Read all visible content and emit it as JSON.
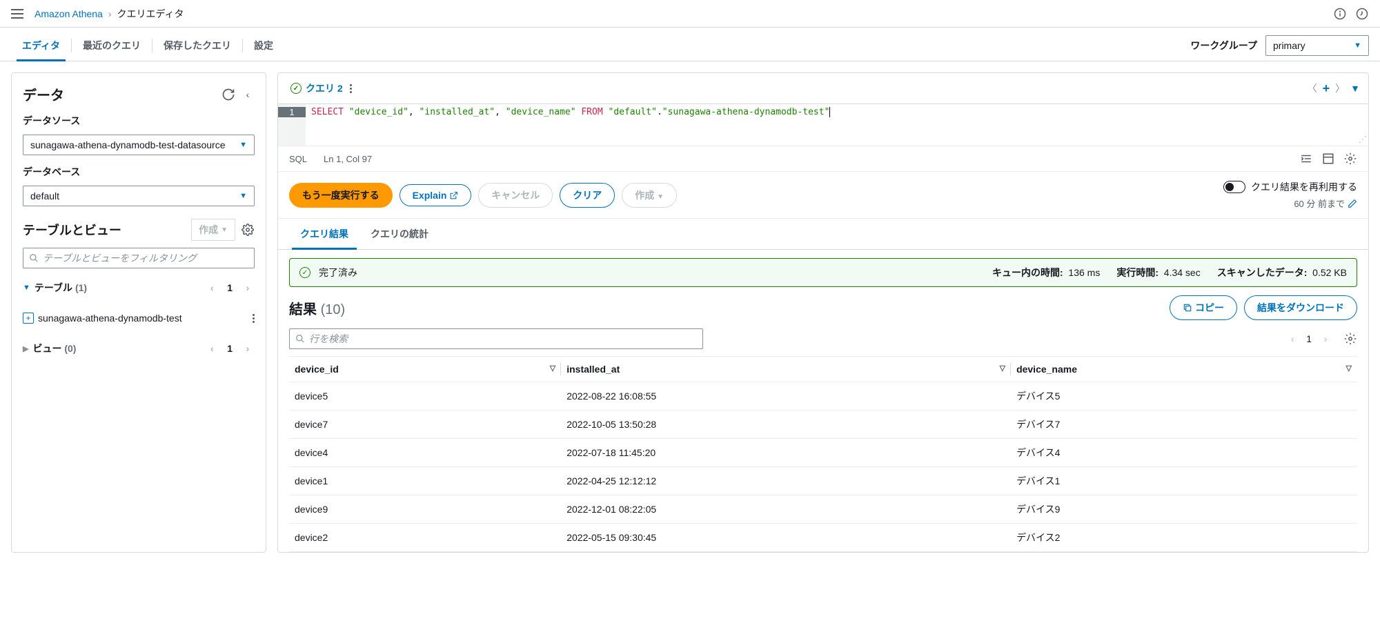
{
  "breadcrumb": {
    "service": "Amazon Athena",
    "page": "クエリエディタ"
  },
  "tabs": {
    "editor": "エディタ",
    "recent": "最近のクエリ",
    "saved": "保存したクエリ",
    "settings": "設定"
  },
  "workgroup": {
    "label": "ワークグループ",
    "value": "primary"
  },
  "sidebar": {
    "title": "データ",
    "datasource_label": "データソース",
    "datasource_value": "sunagawa-athena-dynamodb-test-datasource",
    "database_label": "データベース",
    "database_value": "default",
    "tables_views_title": "テーブルとビュー",
    "create_btn": "作成",
    "filter_placeholder": "テーブルとビューをフィルタリング",
    "tables": {
      "label": "テーブル",
      "count": "(1)",
      "page": "1",
      "item": "sunagawa-athena-dynamodb-test"
    },
    "views": {
      "label": "ビュー",
      "count": "(0)",
      "page": "1"
    }
  },
  "editor": {
    "tab_label": "クエリ 2",
    "line": "1",
    "sql": {
      "kw1": "SELECT",
      "s1": "\"device_id\"",
      "c1": ", ",
      "s2": "\"installed_at\"",
      "c2": ", ",
      "s3": "\"device_name\"",
      "kw2": " FROM ",
      "s4": "\"default\"",
      "dot": ".",
      "s5": "\"sunagawa-athena-dynamodb-test\""
    },
    "lang": "SQL",
    "pos": "Ln 1, Col 97"
  },
  "actions": {
    "run": "もう一度実行する",
    "explain": "Explain",
    "cancel": "キャンセル",
    "clear": "クリア",
    "create": "作成",
    "reuse_label": "クエリ結果を再利用する",
    "reuse_time": "60 分 前まで"
  },
  "result_tabs": {
    "results": "クエリ結果",
    "stats": "クエリの統計"
  },
  "status": {
    "text": "完了済み",
    "queue_label": "キュー内の時間:",
    "queue_val": "136 ms",
    "run_label": "実行時間:",
    "run_val": "4.34 sec",
    "scan_label": "スキャンしたデータ:",
    "scan_val": "0.52 KB"
  },
  "results": {
    "title": "結果",
    "count": "(10)",
    "copy_btn": "コピー",
    "download_btn": "結果をダウンロード",
    "search_placeholder": "行を検索",
    "page": "1",
    "columns": [
      "device_id",
      "installed_at",
      "device_name"
    ],
    "rows": [
      {
        "c0": "device5",
        "c1": "2022-08-22 16:08:55",
        "c2": "デバイス5"
      },
      {
        "c0": "device7",
        "c1": "2022-10-05 13:50:28",
        "c2": "デバイス7"
      },
      {
        "c0": "device4",
        "c1": "2022-07-18 11:45:20",
        "c2": "デバイス4"
      },
      {
        "c0": "device1",
        "c1": "2022-04-25 12:12:12",
        "c2": "デバイス1"
      },
      {
        "c0": "device9",
        "c1": "2022-12-01 08:22:05",
        "c2": "デバイス9"
      },
      {
        "c0": "device2",
        "c1": "2022-05-15 09:30:45",
        "c2": "デバイス2"
      }
    ]
  }
}
